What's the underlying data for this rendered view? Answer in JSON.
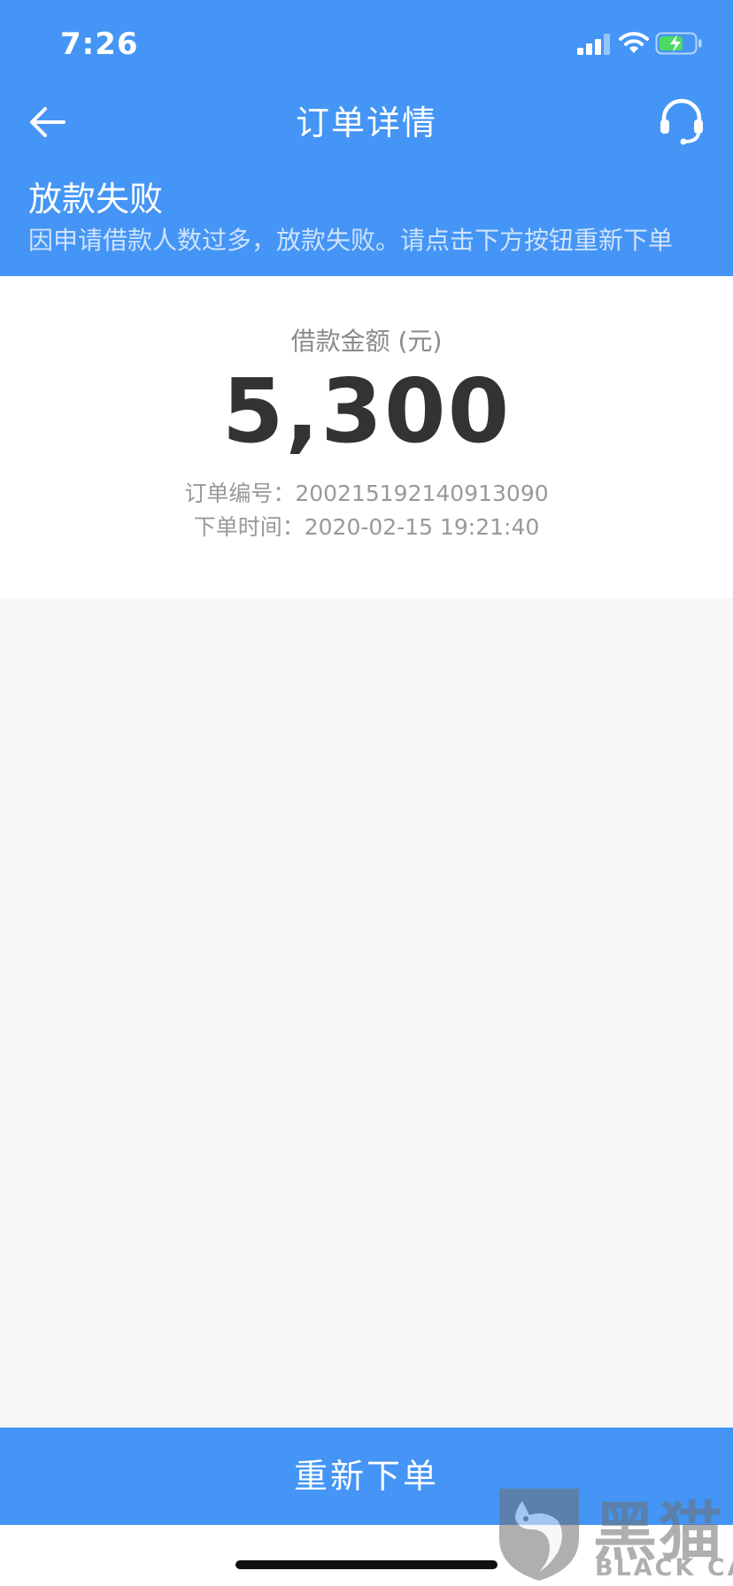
{
  "status_bar": {
    "time": "7:26",
    "icons": [
      "signal-icon",
      "wifi-icon",
      "battery-charging-icon"
    ]
  },
  "header": {
    "title": "订单详情",
    "back_icon": "arrow-left-icon",
    "support_icon": "headset-icon"
  },
  "order_status": {
    "title": "放款失败",
    "description": "因申请借款人数过多，放款失败。请点击下方按钮重新下单"
  },
  "loan": {
    "amount_label": "借款金额 (元)",
    "amount": "5,300",
    "order_number_line": "订单编号：200215192140913090",
    "order_time_line": "下单时间：2020-02-15 19:21:40"
  },
  "actions": {
    "reorder_label": "重新下单"
  },
  "watermark": {
    "text_cn": "黑猫",
    "text_en": "BLACK CAT"
  },
  "colors": {
    "primary": "#4495f5",
    "background": "#f7f7f7",
    "card": "#ffffff",
    "amount_text": "#333333",
    "secondary_text": "#999999"
  }
}
